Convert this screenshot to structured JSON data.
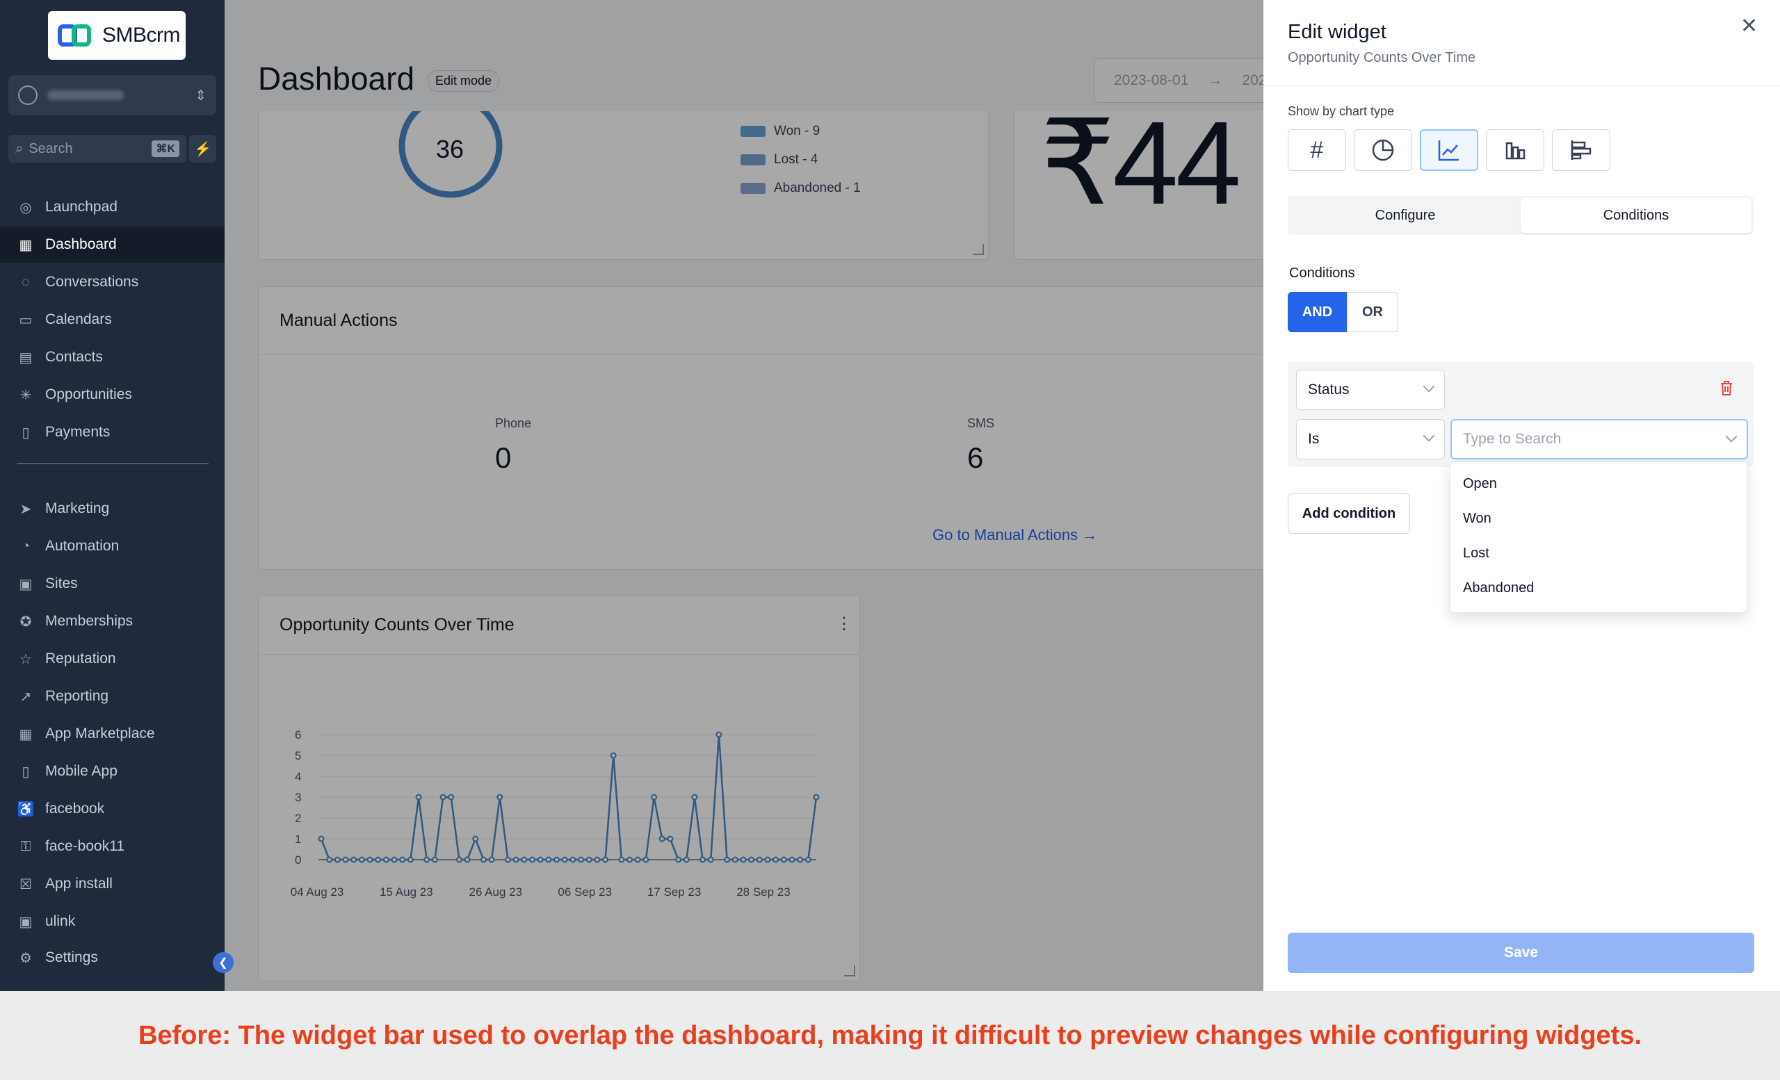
{
  "brand": {
    "name": "SMBcrm"
  },
  "sidebar": {
    "search_placeholder": "Search",
    "search_shortcut": "⌘K",
    "items": [
      {
        "label": "Launchpad",
        "icon": "launchpad-icon",
        "active": false
      },
      {
        "label": "Dashboard",
        "icon": "dashboard-icon",
        "active": true
      },
      {
        "label": "Conversations",
        "icon": "chat-icon",
        "active": false
      },
      {
        "label": "Calendars",
        "icon": "calendar-icon",
        "active": false
      },
      {
        "label": "Contacts",
        "icon": "contacts-icon",
        "active": false
      },
      {
        "label": "Opportunities",
        "icon": "opportunities-icon",
        "active": false
      },
      {
        "label": "Payments",
        "icon": "payments-icon",
        "active": false
      },
      {
        "label": "Marketing",
        "icon": "send-icon",
        "active": false
      },
      {
        "label": "Automation",
        "icon": "automation-icon",
        "active": false
      },
      {
        "label": "Sites",
        "icon": "sites-icon",
        "active": false
      },
      {
        "label": "Memberships",
        "icon": "award-icon",
        "active": false
      },
      {
        "label": "Reputation",
        "icon": "star-icon",
        "active": false
      },
      {
        "label": "Reporting",
        "icon": "trend-icon",
        "active": false
      },
      {
        "label": "App Marketplace",
        "icon": "grid-icon",
        "active": false
      },
      {
        "label": "Mobile App",
        "icon": "mobile-icon",
        "active": false
      },
      {
        "label": "facebook",
        "icon": "accessibility-icon",
        "active": false
      },
      {
        "label": "face-book11",
        "icon": "key-icon",
        "active": false
      },
      {
        "label": "App install",
        "icon": "x-box-icon",
        "active": false
      },
      {
        "label": "ulink",
        "icon": "play-box-icon",
        "active": false
      }
    ],
    "settings_label": "Settings"
  },
  "header": {
    "title": "Dashboard",
    "badge": "Edit mode",
    "date_start": "2023-08-01",
    "date_end_partial": "202"
  },
  "status_widget": {
    "total": "36",
    "legend": [
      {
        "label": "Won - 9",
        "color": "#60a5d8"
      },
      {
        "label": "Lost - 4",
        "color": "#7d9fd0"
      },
      {
        "label": "Abandoned - 1",
        "color": "#8aa6d4"
      }
    ]
  },
  "revenue_widget": {
    "value": "₹44"
  },
  "manual_actions": {
    "title": "Manual Actions",
    "stats": [
      {
        "label": "Phone",
        "value": "0"
      },
      {
        "label": "SMS",
        "value": "6"
      }
    ],
    "link": "Go to Manual Actions"
  },
  "opportunity_chart_card": {
    "title": "Opportunity Counts Over Time"
  },
  "chart_data": {
    "type": "line",
    "title": "Opportunity Counts Over Time",
    "xlabel": "",
    "ylabel": "",
    "ylim": [
      0,
      6
    ],
    "yticks": [
      "0",
      "1",
      "2",
      "3",
      "4",
      "5",
      "6"
    ],
    "xtick_labels": [
      "04 Aug 23",
      "15 Aug 23",
      "26 Aug 23",
      "06 Sep 23",
      "17 Sep 23",
      "28 Sep 23"
    ],
    "series": [
      {
        "name": "",
        "color": "#4a86c5",
        "values": [
          1,
          0,
          0,
          0,
          0,
          0,
          0,
          0,
          0,
          0,
          0,
          0,
          3,
          0,
          0,
          3,
          3,
          0,
          0,
          1,
          0,
          0,
          3,
          0,
          0,
          0,
          0,
          0,
          0,
          0,
          0,
          0,
          0,
          0,
          0,
          0,
          5,
          0,
          0,
          0,
          0,
          3,
          1,
          1,
          0,
          0,
          3,
          0,
          0,
          6,
          0,
          0,
          0,
          0,
          0,
          0,
          0,
          0,
          0,
          0,
          0,
          3
        ]
      }
    ],
    "grid": true,
    "legend": "none"
  },
  "edit_panel": {
    "title": "Edit widget",
    "subtitle": "Opportunity Counts Over Time",
    "chart_type_label": "Show by chart type",
    "chart_types": [
      {
        "icon": "hash-icon",
        "active": false
      },
      {
        "icon": "pie-chart-icon",
        "active": false
      },
      {
        "icon": "line-chart-icon",
        "active": true
      },
      {
        "icon": "bar-chart-icon",
        "active": false
      },
      {
        "icon": "horizontal-bar-icon",
        "active": false
      }
    ],
    "tabs": [
      "Configure",
      "Conditions"
    ],
    "active_tab": "Conditions",
    "conditions_label": "Conditions",
    "and_label": "AND",
    "or_label": "OR",
    "field_select": "Status",
    "operator_select": "Is",
    "value_placeholder": "Type to Search",
    "dropdown_options": [
      "Open",
      "Won",
      "Lost",
      "Abandoned"
    ],
    "add_condition_label": "Add condition",
    "save_label": "Save"
  },
  "caption": "Before: The widget bar used to overlap the dashboard, making it difficult to preview changes while configuring widgets."
}
